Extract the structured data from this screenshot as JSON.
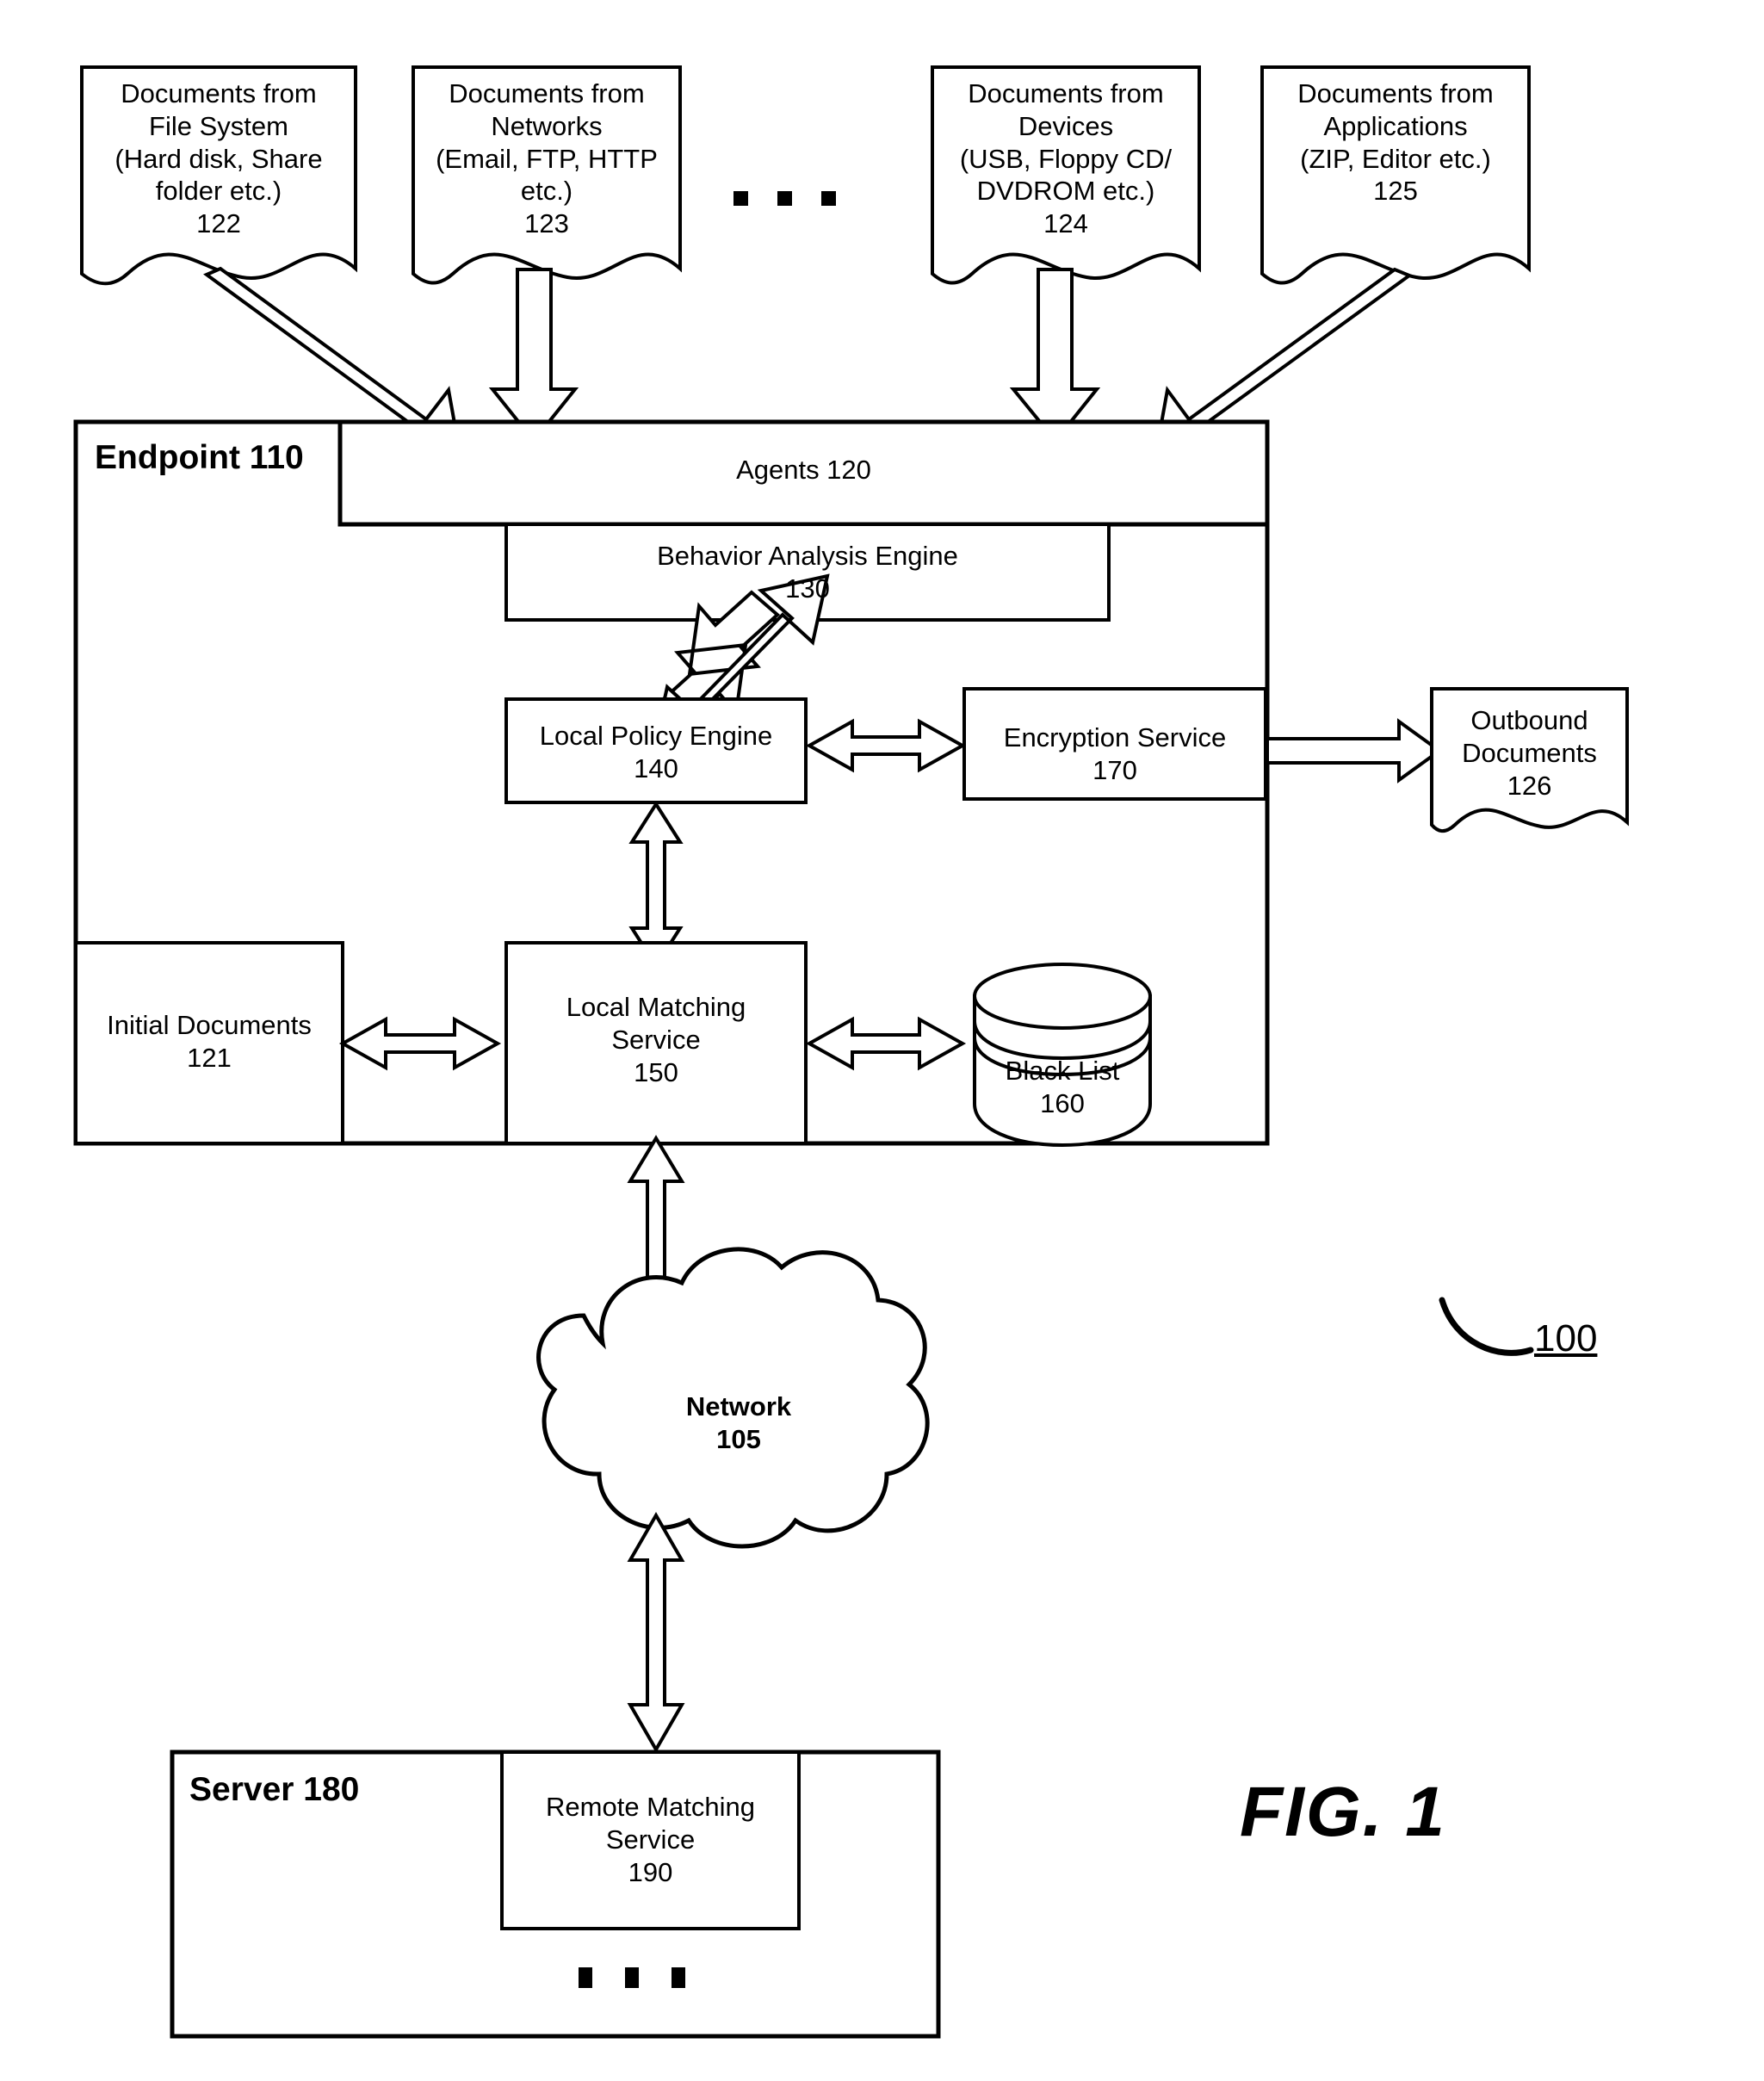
{
  "figure": {
    "caption": "FIG. 1",
    "system_reference": "100"
  },
  "sources": [
    {
      "id": "122",
      "name": "documents-from-file-system",
      "text": "Documents from\nFile System\n(Hard disk, Share\nfolder etc.)\n122"
    },
    {
      "id": "123",
      "name": "documents-from-networks",
      "text": "Documents from\nNetworks\n(Email, FTP, HTTP\netc.)\n123"
    },
    {
      "id": "124",
      "name": "documents-from-devices",
      "text": "Documents from\nDevices\n(USB, Floppy CD/\nDVDROM etc.)\n124"
    },
    {
      "id": "125",
      "name": "documents-from-applications",
      "text": "Documents from\nApplications\n(ZIP, Editor etc.)\n125"
    }
  ],
  "endpoint": {
    "title": "Endpoint 110",
    "agents": "Agents 120",
    "behavior_analysis_engine": "Behavior Analysis Engine\n130",
    "local_policy_engine": "Local Policy Engine\n140",
    "encryption_service": "Encryption Service\n170",
    "initial_documents": "Initial Documents\n121",
    "local_matching_service": "Local Matching\nService\n150",
    "black_list": "Black List\n160"
  },
  "outbound": {
    "documents": "Outbound\nDocuments\n126"
  },
  "network": {
    "label": "Network\n105"
  },
  "server": {
    "title": "Server 180",
    "remote_matching_service": "Remote Matching\nService\n190"
  },
  "colors": {
    "stroke": "#000000",
    "fill": "#ffffff",
    "background": "#ffffff"
  },
  "ellipsis": {
    "top_dots": 3,
    "server_dots": 3
  }
}
